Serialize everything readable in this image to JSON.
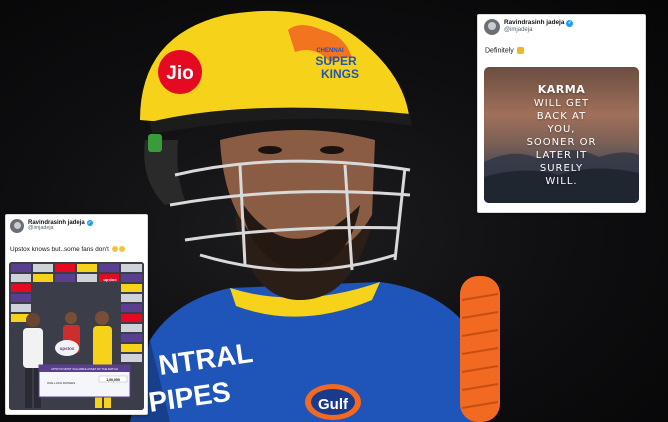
{
  "helmet": {
    "sponsor": "Jio",
    "team_line1": "CHENNAI",
    "team_line2": "SUPER",
    "team_line3": "KINGS"
  },
  "jersey": {
    "text1": "NTRAL",
    "text2": "PIPES",
    "sponsor": "Gulf"
  },
  "tweet_right": {
    "display_name": "Ravindrasinh jadeja",
    "handle": "@imjadeja",
    "text": "Definitely",
    "image_lines": [
      "KARMA",
      "WILL GET",
      "BACK AT",
      "YOU,",
      "SOONER OR",
      "LATER IT",
      "SURELY",
      "WILL."
    ]
  },
  "tweet_left": {
    "display_name": "Ravindrasinh jadeja",
    "handle": "@imjadeja",
    "text": "Upstox knows but..some fans don't",
    "photo": {
      "board_brand": "upstox",
      "cheque_title": "UPSTOX MOST VALUABLE ASSET OF THE MATCH",
      "cheque_amount": "1,00,000",
      "cheque_words": "ONE LAKH RUPEES",
      "ball_brand": "upstox"
    }
  },
  "colors": {
    "csk_yellow": "#f7d21b",
    "jersey_blue": "#1f55b8",
    "jio_red": "#e30a21",
    "bat_orange": "#f26a21",
    "verified_blue": "#1d9bf0"
  }
}
